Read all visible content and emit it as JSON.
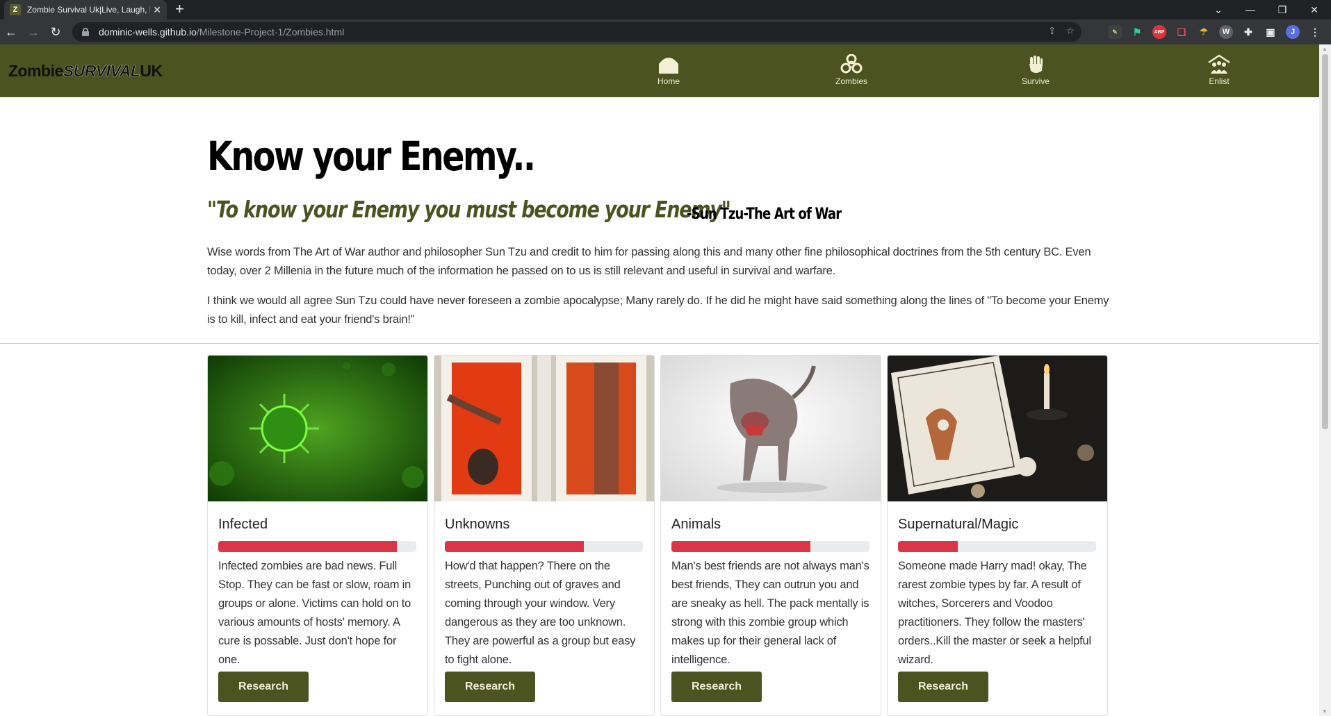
{
  "browser": {
    "tab_title": "Zombie Survival Uk|Live, Laugh, L",
    "tab_favicon": "Z",
    "url_host": "dominic-wells.github.io",
    "url_path": "/Milestone-Project-1/Zombies.html",
    "profile_initial": "J"
  },
  "site": {
    "brand_part1": "Zombie",
    "brand_part2": "SURVIVAL",
    "brand_part3": "UK",
    "nav": [
      {
        "label": "Home",
        "icon": "home-icon"
      },
      {
        "label": "Zombies",
        "icon": "biohazard-icon"
      },
      {
        "label": "Survive",
        "icon": "fist-icon"
      },
      {
        "label": "Enlist",
        "icon": "group-icon"
      }
    ],
    "colors": {
      "nav_bg": "#4b5320",
      "nav_text": "#f3efd4",
      "bar_fill": "#dc3545"
    }
  },
  "main": {
    "title": "Know your Enemy..",
    "quote": "\"To know your Enemy you must become your Enemy\"",
    "quote_attr": "-Sun Tzu-The Art of War",
    "para1": "Wise words from The Art of War author and philosopher Sun Tzu and credit to him for passing along this and many other fine philosophical doctrines from the 5th century BC. Even today, over 2 Millenia in the future much of the information he passed on to us is still relevant and useful in survival and warfare.",
    "para2": "I think we would all agree Sun Tzu could have never foreseen a zombie apocalypse; Many rarely do. If he did he might have said something along the lines of \"To become your Enemy is to kill, infect and eat your friend's brain!\""
  },
  "cards": [
    {
      "title": "Infected",
      "level": 0.9,
      "text": "Infected zombies are bad news. Full Stop. They can be fast or slow, roam in groups or alone. Victims can hold on to various amounts of hosts' memory. A cure is possable. Just don't hope for one.",
      "button": "Research"
    },
    {
      "title": "Unknowns",
      "level": 0.7,
      "text": "How'd that happen? There on the streets, Punching out of graves and coming through your window. Very dangerous as they are too unknown. They are powerful as a group but easy to fight alone.",
      "button": "Research"
    },
    {
      "title": "Animals",
      "level": 0.7,
      "text": "Man's best friends are not always man's best friends, They can outrun you and are sneaky as hell. The pack mentally is strong with this zombie group which makes up for their general lack of intelligence.",
      "button": "Research"
    },
    {
      "title": "Supernatural/Magic",
      "level": 0.3,
      "text": "Someone made Harry mad! okay, The rarest zombie types by far. A result of witches, Sorcerers and Voodoo practitioners. They follow the masters' orders..Kill the master or seek a helpful wizard.",
      "button": "Research"
    }
  ]
}
